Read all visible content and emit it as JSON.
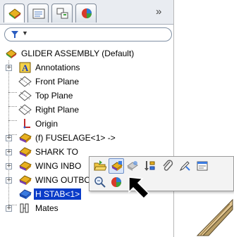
{
  "header": {
    "overflow_chevron": "»",
    "filter_dropdown_arrow": "▼"
  },
  "tree": {
    "root_label": "GLIDER ASSEMBLY  (Default)",
    "items": [
      {
        "label": "Annotations",
        "expander": "+"
      },
      {
        "label": "Front Plane",
        "expander": ""
      },
      {
        "label": "Top Plane",
        "expander": ""
      },
      {
        "label": "Right Plane",
        "expander": ""
      },
      {
        "label": "Origin",
        "expander": ""
      },
      {
        "label": "(f) FUSELAGE<1> ->",
        "expander": "+"
      },
      {
        "label": "SHARK TO",
        "expander": "+"
      },
      {
        "label": "WING INBO",
        "expander": "+"
      },
      {
        "label": "WING OUTBOARD<1>",
        "expander": "+"
      },
      {
        "label": "H STAB<1>",
        "expander": "",
        "selected": true
      },
      {
        "label": "Mates",
        "expander": "+"
      }
    ]
  },
  "colors": {
    "selection": "#0a3cc8",
    "part_yellow": "#e8b020",
    "part_purple": "#7a3fb0"
  },
  "icons": {
    "tabs": [
      "feature-manager-icon",
      "property-manager-icon",
      "configuration-manager-icon",
      "display-manager-icon"
    ],
    "toolbar": [
      "open-part-icon",
      "edit-part-icon",
      "hide-components-icon",
      "reorder-icon",
      "paper-clip-icon",
      "appearance-pen-icon",
      "properties-icon",
      "zoom-to-selection-icon",
      "appearance-color-icon"
    ]
  }
}
